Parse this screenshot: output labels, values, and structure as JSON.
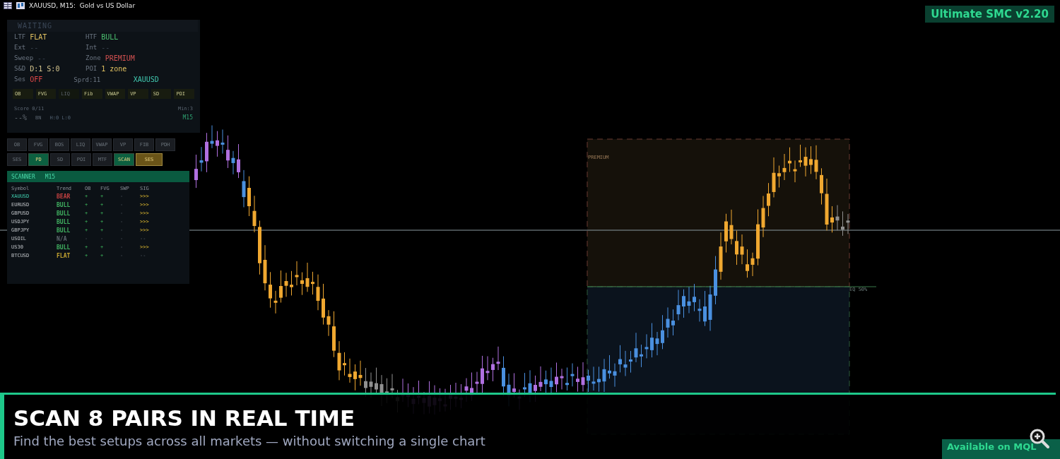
{
  "title_bar": {
    "text": "XAUUSD, M15:  Gold vs US Dollar"
  },
  "badge": "Ultimate SMC v2.20",
  "dashboard": {
    "status": "WAITING",
    "rows": [
      [
        {
          "label": "LTF",
          "value": "FLAT",
          "color": "#e0c060"
        },
        {
          "label": "HTF",
          "value": "BULL",
          "color": "#4cc070"
        }
      ],
      [
        {
          "label": "Ext",
          "value": "--",
          "color": "#3a4450"
        },
        {
          "label": "Int",
          "value": "--",
          "color": "#3a4450"
        }
      ],
      [
        {
          "label": "Sweep",
          "value": "--",
          "color": "#3a4450"
        },
        {
          "label": "Zone",
          "value": "PREMIUM",
          "color": "#d05050"
        }
      ],
      [
        {
          "label": "S&D",
          "value": "D:1 S:0",
          "color": "#d8c890"
        },
        {
          "label": "POI",
          "value": "1 zone",
          "color": "#e0c060"
        }
      ],
      [
        {
          "label": "Ses",
          "value": "OFF",
          "color": "#e04848"
        },
        {
          "label": "Sprd:11"
        },
        {
          "value": "XAUUSD",
          "color": "#40c8b0"
        }
      ]
    ],
    "chips": [
      {
        "label": "OB",
        "active": true
      },
      {
        "label": "FVG",
        "active": true
      },
      {
        "label": "LIQ",
        "active": false
      },
      {
        "label": "Fib",
        "active": true
      },
      {
        "label": "VWAP",
        "active": true
      },
      {
        "label": "VP",
        "active": true
      },
      {
        "label": "SD",
        "active": true
      },
      {
        "label": "POI",
        "active": true
      }
    ],
    "score": "Score 0/11",
    "min": "Min:3",
    "percent": "--%",
    "bias": "BN",
    "hl": "H:0 L:0",
    "timeframe": "M15"
  },
  "toggles": [
    [
      {
        "label": "OB",
        "on": false
      },
      {
        "label": "FVG",
        "on": false
      },
      {
        "label": "BOS",
        "on": false
      },
      {
        "label": "LIQ",
        "on": false
      },
      {
        "label": "VWAP",
        "on": false
      },
      {
        "label": "VP",
        "on": false
      },
      {
        "label": "FIB",
        "on": false
      },
      {
        "label": "PDH",
        "on": false
      }
    ],
    [
      {
        "label": "SES",
        "on": false
      },
      {
        "label": "PD",
        "on": true,
        "color": "#0c6040"
      },
      {
        "label": "SD",
        "on": false
      },
      {
        "label": "POI",
        "on": false
      },
      {
        "label": "MTF",
        "on": false
      },
      {
        "label": "SCAN",
        "on": true,
        "color": "#0c6040"
      },
      {
        "label": "SES",
        "on": true,
        "color": "#6a5418"
      }
    ]
  ],
  "scanner": {
    "title": "SCANNER",
    "timeframe": "M15",
    "columns": [
      "Symbol",
      "Trend",
      "OB",
      "FVG",
      "SWP",
      "SIG"
    ],
    "rows": [
      {
        "symbol": "XAUUSD",
        "selected": true,
        "trend": "BEAR",
        "color": "#c04040",
        "ob": "+",
        "fvg": "+",
        "swp": "-",
        "sig": ">>>",
        "signal": true
      },
      {
        "symbol": "EURUSD",
        "selected": false,
        "trend": "BULL",
        "color": "#40b060",
        "ob": "+",
        "fvg": "+",
        "swp": "-",
        "sig": ">>>",
        "signal": true
      },
      {
        "symbol": "GBPUSD",
        "selected": false,
        "trend": "BULL",
        "color": "#40b060",
        "ob": "+",
        "fvg": "+",
        "swp": "-",
        "sig": ">>>",
        "signal": true
      },
      {
        "symbol": "USDJPY",
        "selected": false,
        "trend": "BULL",
        "color": "#40b060",
        "ob": "+",
        "fvg": "+",
        "swp": "-",
        "sig": ">>>",
        "signal": true
      },
      {
        "symbol": "GBPJPY",
        "selected": false,
        "trend": "BULL",
        "color": "#40b060",
        "ob": "+",
        "fvg": "+",
        "swp": "-",
        "sig": ">>>",
        "signal": true
      },
      {
        "symbol": "USOIL",
        "selected": false,
        "trend": "N/A",
        "color": "#606870",
        "ob": "-",
        "fvg": "-",
        "swp": "-",
        "sig": "--",
        "signal": false
      },
      {
        "symbol": "US30",
        "selected": false,
        "trend": "BULL",
        "color": "#40b060",
        "ob": "+",
        "fvg": "+",
        "swp": "-",
        "sig": ">>>",
        "signal": true
      },
      {
        "symbol": "BTCUSD",
        "selected": false,
        "trend": "FLAT",
        "color": "#c0a030",
        "ob": "+",
        "fvg": "+",
        "swp": "-",
        "sig": "--",
        "signal": false
      }
    ]
  },
  "chart": {
    "premium_label": "PREMIUM",
    "eq_label": "EQ 50%"
  },
  "banner": {
    "headline": "SCAN 8 PAIRS IN REAL TIME",
    "subline": "Find the best setups across all markets — without switching a single chart",
    "cta": "Available on MQL"
  }
}
